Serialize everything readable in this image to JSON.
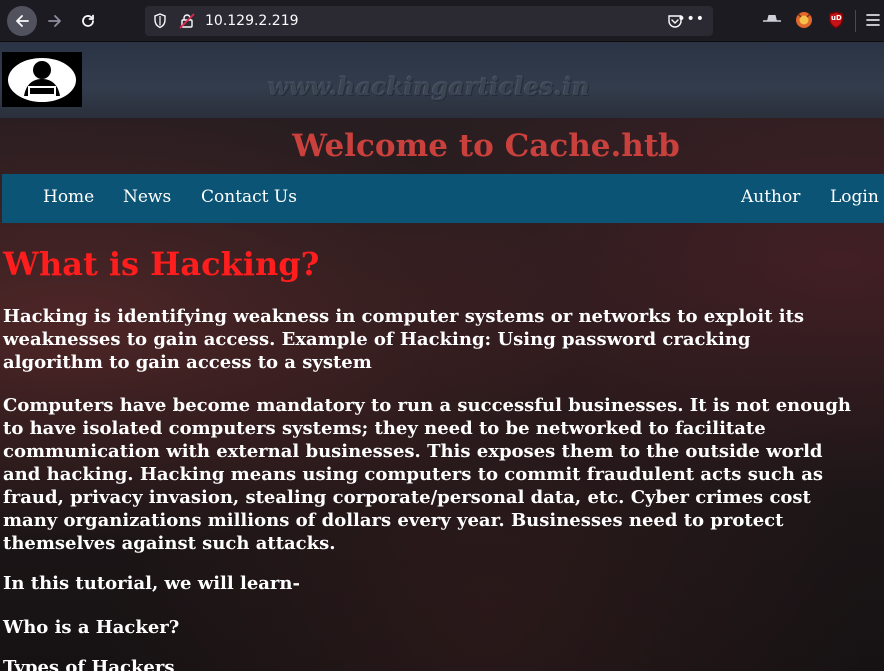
{
  "browser": {
    "url": "10.129.2.219",
    "url_menu": "•••",
    "extensions": [
      "incognito-hat-icon",
      "firefox-relay-icon",
      "ublock-origin-icon"
    ],
    "ublock_label": "uD"
  },
  "site": {
    "watermark": "www.hackingarticles.in",
    "title": "Welcome to Cache.htb",
    "title_color": "#c9403d",
    "nav_color": "#0c5475"
  },
  "nav": {
    "home": "Home",
    "news": "News",
    "contact": "Contact Us",
    "author": "Author",
    "login": "Login"
  },
  "article": {
    "heading": "What is Hacking?",
    "heading_color": "#ff1d1d",
    "p1": "Hacking is identifying weakness in computer systems or networks to exploit its\nweaknesses to gain access. Example of Hacking: Using password cracking\nalgorithm to gain access to a system",
    "p2": "Computers have become mandatory to run a successful businesses. It is not enough\nto have isolated computers systems; they need to be networked to facilitate\ncommunication with external businesses. This exposes them to the outside world\nand hacking. Hacking means using computers to commit fraudulent acts such as\nfraud, privacy invasion, stealing corporate/personal data, etc. Cyber crimes cost\nmany organizations millions of dollars every year. Businesses need to protect\nthemselves against such attacks.",
    "p3": "In this tutorial, we will learn-",
    "p4": "Who is a Hacker?",
    "p5": "Types of Hackers"
  }
}
